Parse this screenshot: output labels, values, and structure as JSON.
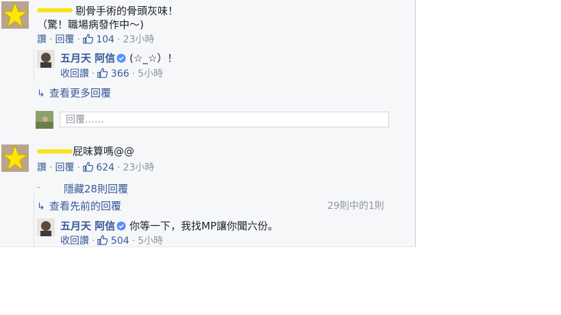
{
  "colors": {
    "link": "#365899",
    "muted": "#90949c",
    "panel": "#f6f7f9",
    "redact": "#ffe11a"
  },
  "comment1": {
    "line1": "剔骨手術的骨頭灰味！",
    "line2": "（驚！職場病發作中～)",
    "actions": {
      "like": "讚",
      "reply": "回覆",
      "likes": "104",
      "time": "23小時"
    },
    "reply": {
      "name": "五月天 阿信",
      "text": "(☆_☆）！",
      "actions": {
        "unlike": "收回讚",
        "likes": "366",
        "time": "5小時"
      }
    },
    "more_replies": "查看更多回覆",
    "reply_placeholder": "回覆……"
  },
  "comment2": {
    "text": "屁味算嗎@@",
    "actions": {
      "like": "讚",
      "reply": "回覆",
      "likes": "624",
      "time": "23小時"
    },
    "hidden": "隱藏28則回覆",
    "previous": "查看先前的回覆",
    "count": "29則中的1則",
    "reply": {
      "name": "五月天 阿信",
      "text": "你等一下，我找MP讓你聞六份。",
      "actions": {
        "unlike": "收回讚",
        "likes": "504",
        "time": "5小時"
      }
    }
  },
  "icons": [
    "star-avatar-icon",
    "verified-badge-icon",
    "thumbs-up-icon",
    "reply-arrow-icon"
  ]
}
